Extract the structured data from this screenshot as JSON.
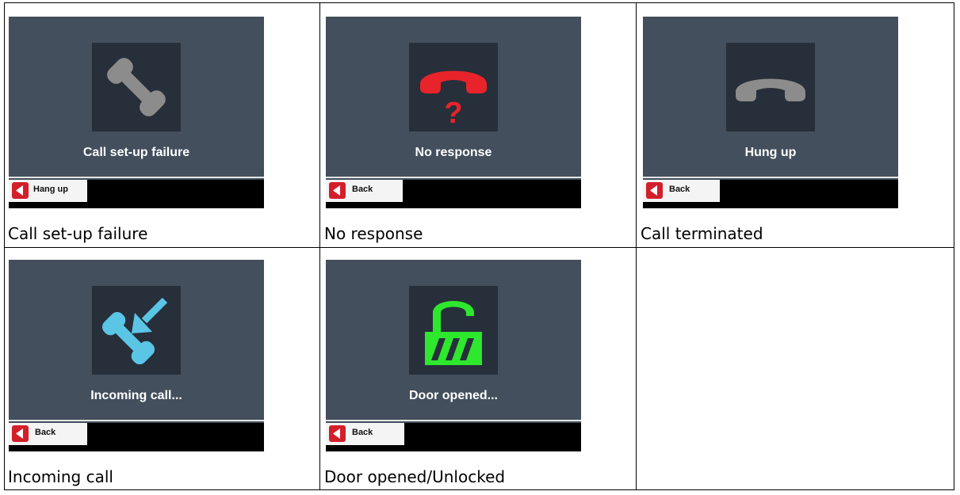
{
  "cells": [
    {
      "screen_title": "Call set-up failure",
      "button_label": "Hang up",
      "caption": "Call set-up failure",
      "icon": "phone-icon"
    },
    {
      "screen_title": "No response",
      "button_label": "Back",
      "caption": "No response",
      "icon": "no-response-phone-icon"
    },
    {
      "screen_title": "Hung up",
      "button_label": "Back",
      "caption": "Call terminated",
      "icon": "hung-up-phone-icon"
    },
    {
      "screen_title": "Incoming call...",
      "button_label": "Back",
      "caption": "Incoming call",
      "icon": "incoming-call-icon"
    },
    {
      "screen_title": "Door opened...",
      "button_label": "Back",
      "caption": "Door opened/Unlocked",
      "icon": "unlocked-padlock-icon"
    }
  ],
  "colors": {
    "screen_bg": "#434f5c",
    "icon_bg": "#272f3a",
    "phone_gray": "#8c8c8c",
    "alert_red": "#e8232a",
    "incoming_blue": "#5bc5e6",
    "unlocked_green": "#2ee82e",
    "button_red": "#d21f2a"
  }
}
